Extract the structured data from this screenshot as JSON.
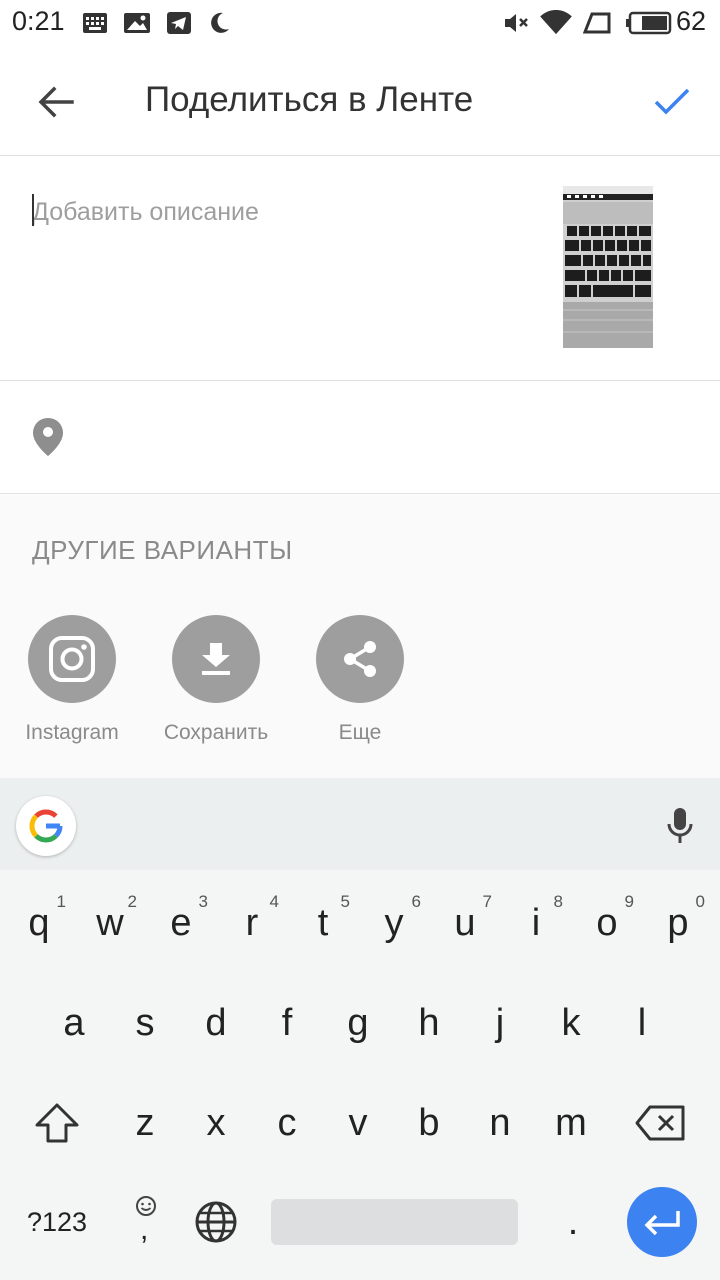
{
  "status_bar": {
    "time": "0:21",
    "battery": "62"
  },
  "app_bar": {
    "title": "Поделиться в Ленте"
  },
  "description": {
    "placeholder": "Добавить описание"
  },
  "other_options": {
    "title": "ДРУГИЕ ВАРИАНТЫ",
    "items": [
      {
        "label": "Instagram",
        "icon": "instagram-icon"
      },
      {
        "label": "Сохранить",
        "icon": "download-icon"
      },
      {
        "label": "Еще",
        "icon": "share-icon"
      }
    ]
  },
  "keyboard": {
    "row1": [
      {
        "key": "q",
        "hint": "1"
      },
      {
        "key": "w",
        "hint": "2"
      },
      {
        "key": "e",
        "hint": "3"
      },
      {
        "key": "r",
        "hint": "4"
      },
      {
        "key": "t",
        "hint": "5"
      },
      {
        "key": "y",
        "hint": "6"
      },
      {
        "key": "u",
        "hint": "7"
      },
      {
        "key": "i",
        "hint": "8"
      },
      {
        "key": "o",
        "hint": "9"
      },
      {
        "key": "p",
        "hint": "0"
      }
    ],
    "row2": [
      "a",
      "s",
      "d",
      "f",
      "g",
      "h",
      "j",
      "k",
      "l"
    ],
    "row3": [
      "z",
      "x",
      "c",
      "v",
      "b",
      "n",
      "m"
    ],
    "symbols_key": "?123",
    "comma_key": ",",
    "period_key": ".",
    "accent": "#3c82f0"
  }
}
